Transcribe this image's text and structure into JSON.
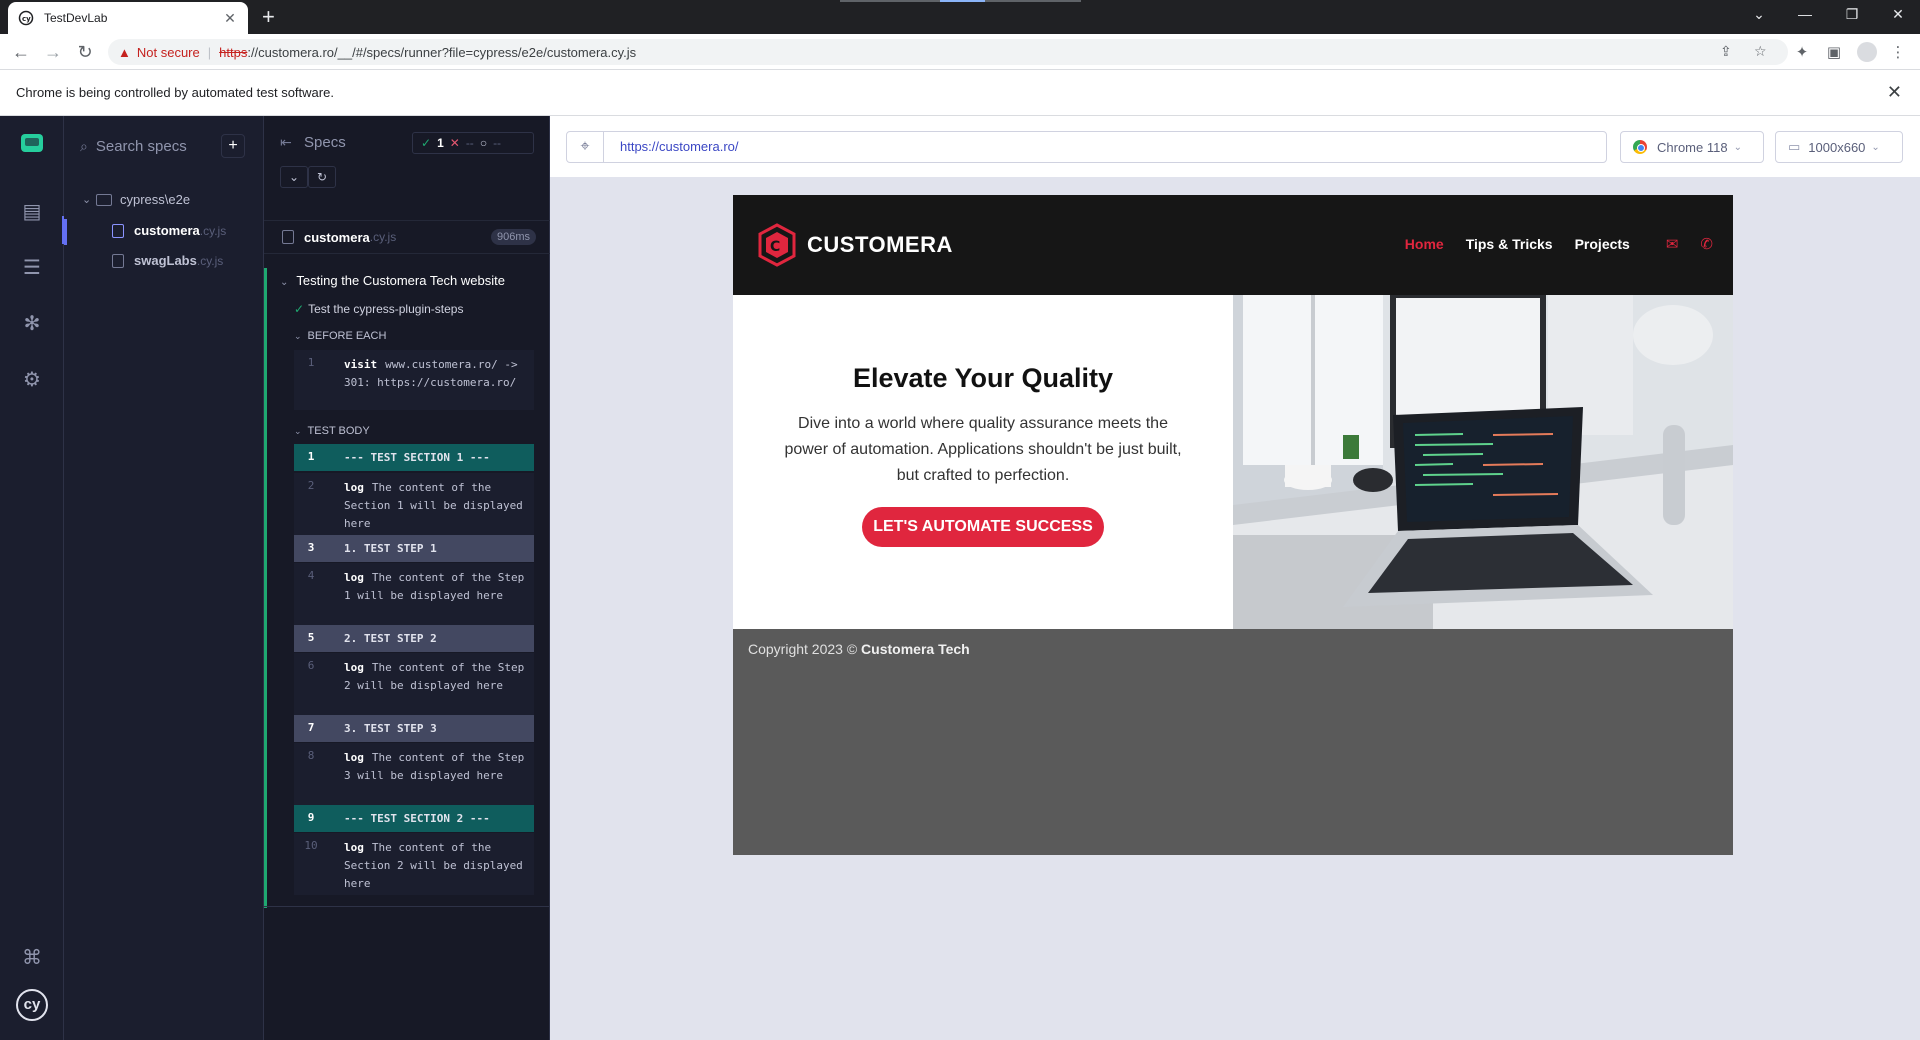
{
  "browser": {
    "tab_title": "TestDevLab",
    "not_secure": "Not secure",
    "url_scheme": "https",
    "url_rest": "://customera.ro/__/#/specs/runner?file=cypress/e2e/customera.cy.js",
    "infobar": "Chrome is being controlled by automated test software."
  },
  "specs_list": {
    "search_placeholder": "Search specs",
    "folder": "cypress\\e2e",
    "files": [
      {
        "name": "customera",
        "ext": ".cy.js"
      },
      {
        "name": "swagLabs",
        "ext": ".cy.js"
      }
    ]
  },
  "reporter": {
    "title": "Specs",
    "passed": "1",
    "failed": "--",
    "pending": "--",
    "file_name": "customera",
    "file_ext": ".cy.js",
    "duration": "906ms",
    "suite": "Testing the Customera Tech website",
    "test": "Test the cypress-plugin-steps",
    "before_each": "BEFORE EACH",
    "test_body": "TEST BODY",
    "commands": [
      {
        "num": "1",
        "kw": "visit",
        "text": "www.customera.ro/ -> 301: https://customera.ro/"
      },
      {
        "num": "1",
        "kw": "",
        "text": "--- TEST SECTION 1 ---"
      },
      {
        "num": "2",
        "kw": "log",
        "text": "The content of the Section 1 will be displayed here"
      },
      {
        "num": "3",
        "kw": "",
        "text": "1. TEST STEP 1"
      },
      {
        "num": "4",
        "kw": "log",
        "text": "The content of the Step 1 will be displayed here"
      },
      {
        "num": "5",
        "kw": "",
        "text": "2. TEST STEP 2"
      },
      {
        "num": "6",
        "kw": "log",
        "text": "The content of the Step 2 will be displayed here"
      },
      {
        "num": "7",
        "kw": "",
        "text": "3. TEST STEP 3"
      },
      {
        "num": "8",
        "kw": "log",
        "text": "The content of the Step 3 will be displayed here"
      },
      {
        "num": "9",
        "kw": "",
        "text": "--- TEST SECTION 2 ---"
      },
      {
        "num": "10",
        "kw": "log",
        "text": "The content of the Section 2 will be displayed here"
      }
    ]
  },
  "aut": {
    "url": "https://customera.ro/",
    "browser": "Chrome 118",
    "viewport": "1000x660"
  },
  "site": {
    "brand": "CUSTOMERA",
    "nav": [
      "Home",
      "Tips & Tricks",
      "Projects"
    ],
    "hero_title": "Elevate Your Quality",
    "hero_text": "Dive into a world where quality assurance meets the power of automation. Applications shouldn't be just built, but crafted to perfection.",
    "cta": "LET'S AUTOMATE SUCCESS",
    "footer_prefix": "Copyright 2023 ©",
    "footer_brand": "Customera Tech"
  },
  "colors": {
    "accent_red": "#e0263e",
    "pass_green": "#1fa971",
    "cypress_indigo": "#6470f3"
  }
}
